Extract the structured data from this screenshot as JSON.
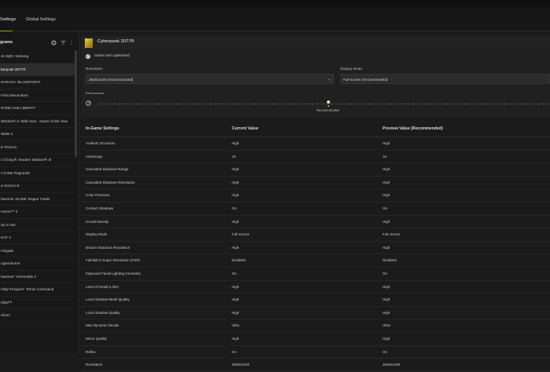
{
  "tabs": [
    "Settings",
    "Global Settings"
  ],
  "sidebar": {
    "title": "grams",
    "items": [
      "ck Myth: Wukong",
      "berpunk 2077®",
      "NARAKA: BLADEPOINT",
      "First Descendent",
      "RONE AND LIBERTY",
      "Witcher® 3: Wild Hunt - Game of the Year",
      "Wake 2",
      "E FINALS",
      "l of Duty®: Modern Warfare® III",
      "l of War Ragnarök",
      "a Horizon 5",
      "hammer 40,000: Rogue Trader",
      "nment™ II",
      "dy or Not",
      "DAY 3",
      "mingate",
      "ngeonborne",
      "hammer: Vermintide 2",
      "rship Troopers: Terran Command",
      "rfield™",
      "rdoon"
    ],
    "selected_index": 1
  },
  "game": {
    "title": "Cyberpunk 2077®",
    "status": "Game isn't optimized"
  },
  "resolution": {
    "label": "Resolution",
    "value": "3840x2160 (recommended)"
  },
  "display_mode": {
    "label": "Display Mode",
    "value": "Full-screen (recommended)"
  },
  "performance": {
    "label": "Performance",
    "marker_label": "Recommended"
  },
  "table": {
    "headers": [
      "In-Game Settings",
      "Current Value",
      "Preview Value (Recommended)"
    ],
    "rows": [
      [
        "Ambient Occlusion",
        "High",
        "High"
      ],
      [
        "Anisotropy",
        "16",
        "16"
      ],
      [
        "Cascaded Shadows Range",
        "High",
        "High"
      ],
      [
        "Cascaded Shadows Resolution",
        "High",
        "High"
      ],
      [
        "Color Precision",
        "High",
        "High"
      ],
      [
        "Contact Shadows",
        "On",
        "On"
      ],
      [
        "Crowd Density",
        "High",
        "High"
      ],
      [
        "Display Mode",
        "Full-screen",
        "Full-screen"
      ],
      [
        "Distant Shadows Resolution",
        "High",
        "High"
      ],
      [
        "FidelityFX Super Resolution (FSR)",
        "Disabled",
        "Disabled"
      ],
      [
        "Improved Facial Lighting Geometry",
        "On",
        "On"
      ],
      [
        "Level of Detail (LOD)",
        "High",
        "High"
      ],
      [
        "Local Shadow Mesh Quality",
        "High",
        "High"
      ],
      [
        "Local Shadow Quality",
        "High",
        "High"
      ],
      [
        "Max Dynamic Decals",
        "Ultra",
        "Ultra"
      ],
      [
        "Mirror Quality",
        "High",
        "High"
      ],
      [
        "Reflex",
        "On",
        "On"
      ],
      [
        "Resolution",
        "3840x2160",
        "3840x2160"
      ]
    ]
  }
}
